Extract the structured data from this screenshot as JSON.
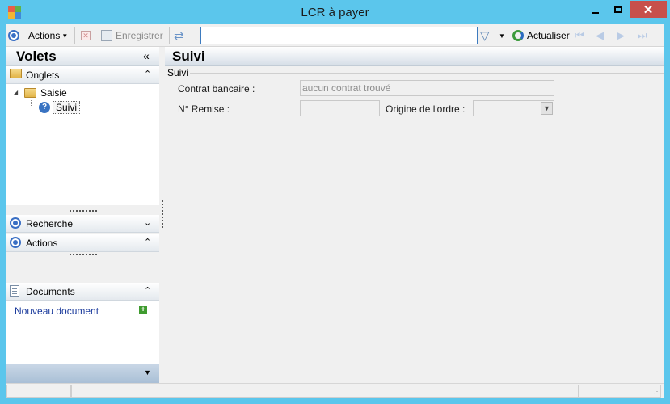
{
  "window": {
    "title": "LCR à payer"
  },
  "toolbar": {
    "actions_label": "Actions",
    "save_label": "Enregistrer",
    "search_value": "",
    "refresh_label": "Actualiser"
  },
  "left_panel": {
    "title": "Volets",
    "onglets": {
      "label": "Onglets",
      "tree": {
        "root": "Saisie",
        "child": "Suivi"
      }
    },
    "recherche": {
      "label": "Recherche"
    },
    "actions": {
      "label": "Actions"
    },
    "documents": {
      "label": "Documents",
      "new_document": "Nouveau document"
    }
  },
  "main": {
    "title": "Suivi",
    "group_title": "Suivi",
    "fields": {
      "contrat_label": "Contrat bancaire :",
      "contrat_value": "aucun contrat trouvé",
      "remise_label": "N° Remise :",
      "remise_value": "",
      "origine_label": "Origine de l'ordre :",
      "origine_value": ""
    }
  },
  "colors": {
    "window_border": "#5bc6ec",
    "close_button": "#c7504b",
    "accent_blue": "#3a6fc4",
    "link": "#1a3a9c"
  }
}
